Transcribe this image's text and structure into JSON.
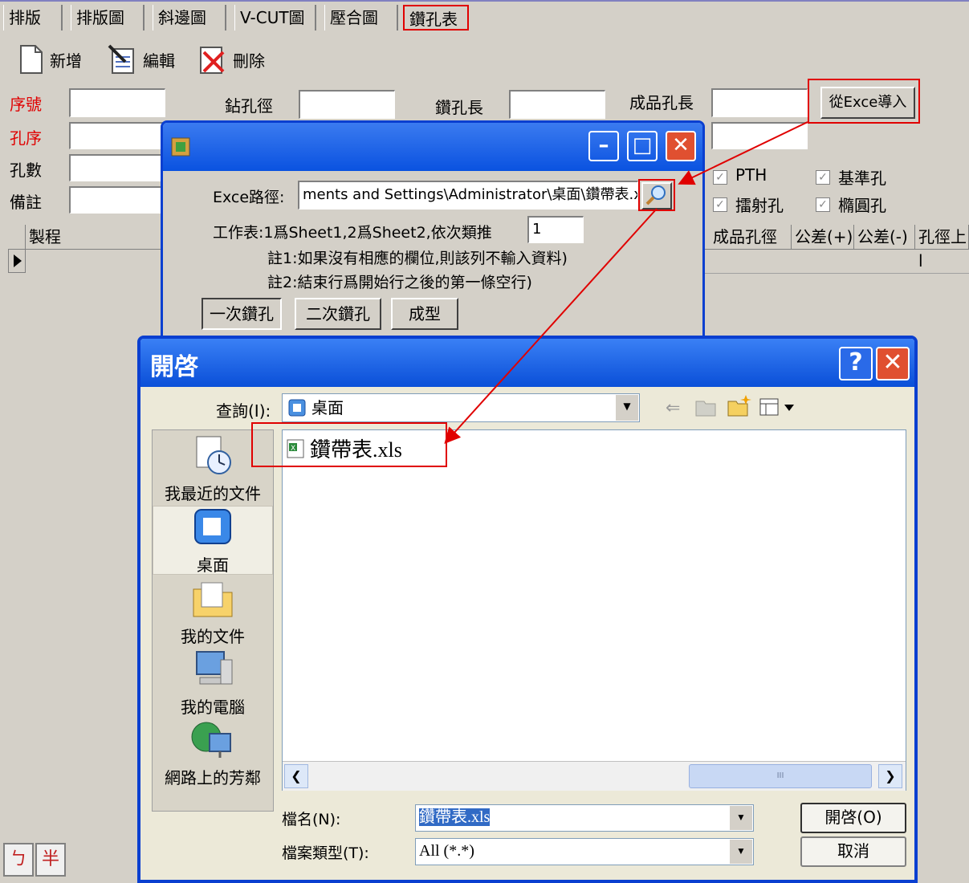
{
  "tabs": [
    "排版",
    "排版圖",
    "斜邊圖",
    "V-CUT圖",
    "壓合圖",
    "鑽孔表"
  ],
  "toolbar": {
    "new": "新增",
    "edit": "編輯",
    "delete": "刪除"
  },
  "form": {
    "seq_label": "序號",
    "drill_dia_label": "鉆孔徑",
    "drill_len_label": "鑽孔長",
    "finished_len_label": "成品孔長",
    "hole_order_label": "孔序",
    "hole_count_label": "孔數",
    "remark_label": "備註",
    "import_button": "從Exce導入",
    "checks": [
      "PTH",
      "基準孔",
      "擂射孔",
      "橢圓孔"
    ]
  },
  "grid": {
    "columns": [
      "製程",
      "成品孔徑",
      "公差(+)",
      "公差(-)",
      "孔徑上l"
    ]
  },
  "ime": [
    "ㄅ",
    "半"
  ],
  "excel_dialog": {
    "path_label": "Exce路徑:",
    "path_value": "ments and Settings\\Administrator\\桌面\\鑽帶表.xls",
    "sheet_label": "工作表:1爲Sheet1,2爲Sheet2,依次類推",
    "sheet_value": "1",
    "note1": "註1:如果沒有相應的欄位,則該列不輸入資料)",
    "note2": "註2:結束行爲開始行之後的第一條空行)",
    "tabs": [
      "一次鑽孔",
      "二次鑽孔",
      "成型"
    ]
  },
  "open_dialog": {
    "title": "開啓",
    "lookin_label": "查詢(I):",
    "lookin_value": "桌面",
    "places": [
      "我最近的文件",
      "桌面",
      "我的文件",
      "我的電腦",
      "網路上的芳鄰"
    ],
    "files": [
      "鑽帶表.xls"
    ],
    "filename_label": "檔名(N):",
    "filename_value": "鑽帶表.xls",
    "filetype_label": "檔案類型(T):",
    "filetype_value": "All (*.*)",
    "open_button": "開啓(O)",
    "cancel_button": "取消",
    "scroll_grip": "III"
  },
  "colors": {
    "accent_red": "#e00000",
    "title_blue": "#0a52e0"
  }
}
